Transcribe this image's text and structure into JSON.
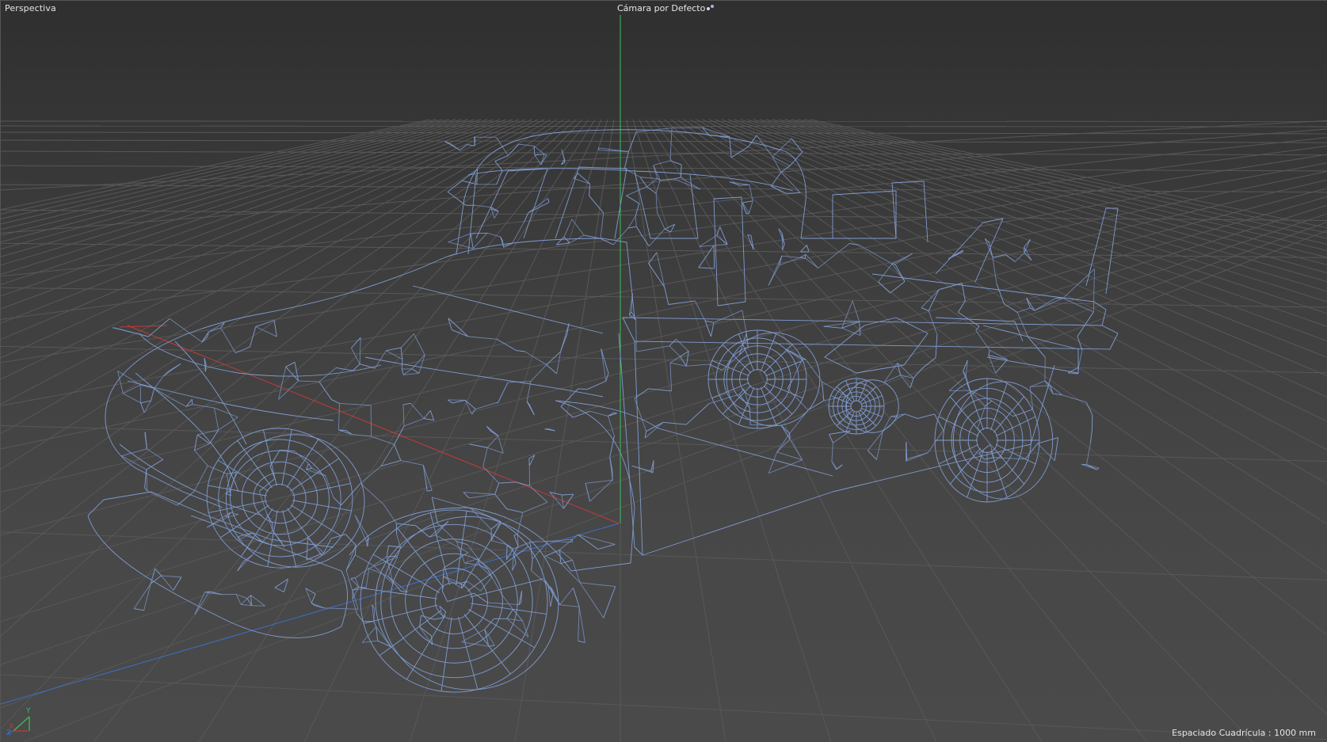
{
  "viewport": {
    "view_name": "Perspectiva",
    "camera_name": "Cámara por Defecto",
    "grid_spacing": "Espaciado Cuadrícula : 1000 mm"
  },
  "gizmo": {
    "x_label": "X",
    "y_label": "Y",
    "z_label": "Z"
  },
  "colors": {
    "wire": "#7f9bd0",
    "axis_x": "#c43a3a",
    "axis_y": "#3fbf5a",
    "axis_z": "#3c6fc7",
    "grid": "#585858"
  },
  "icons": {
    "camera": "camera-settings-icon"
  }
}
